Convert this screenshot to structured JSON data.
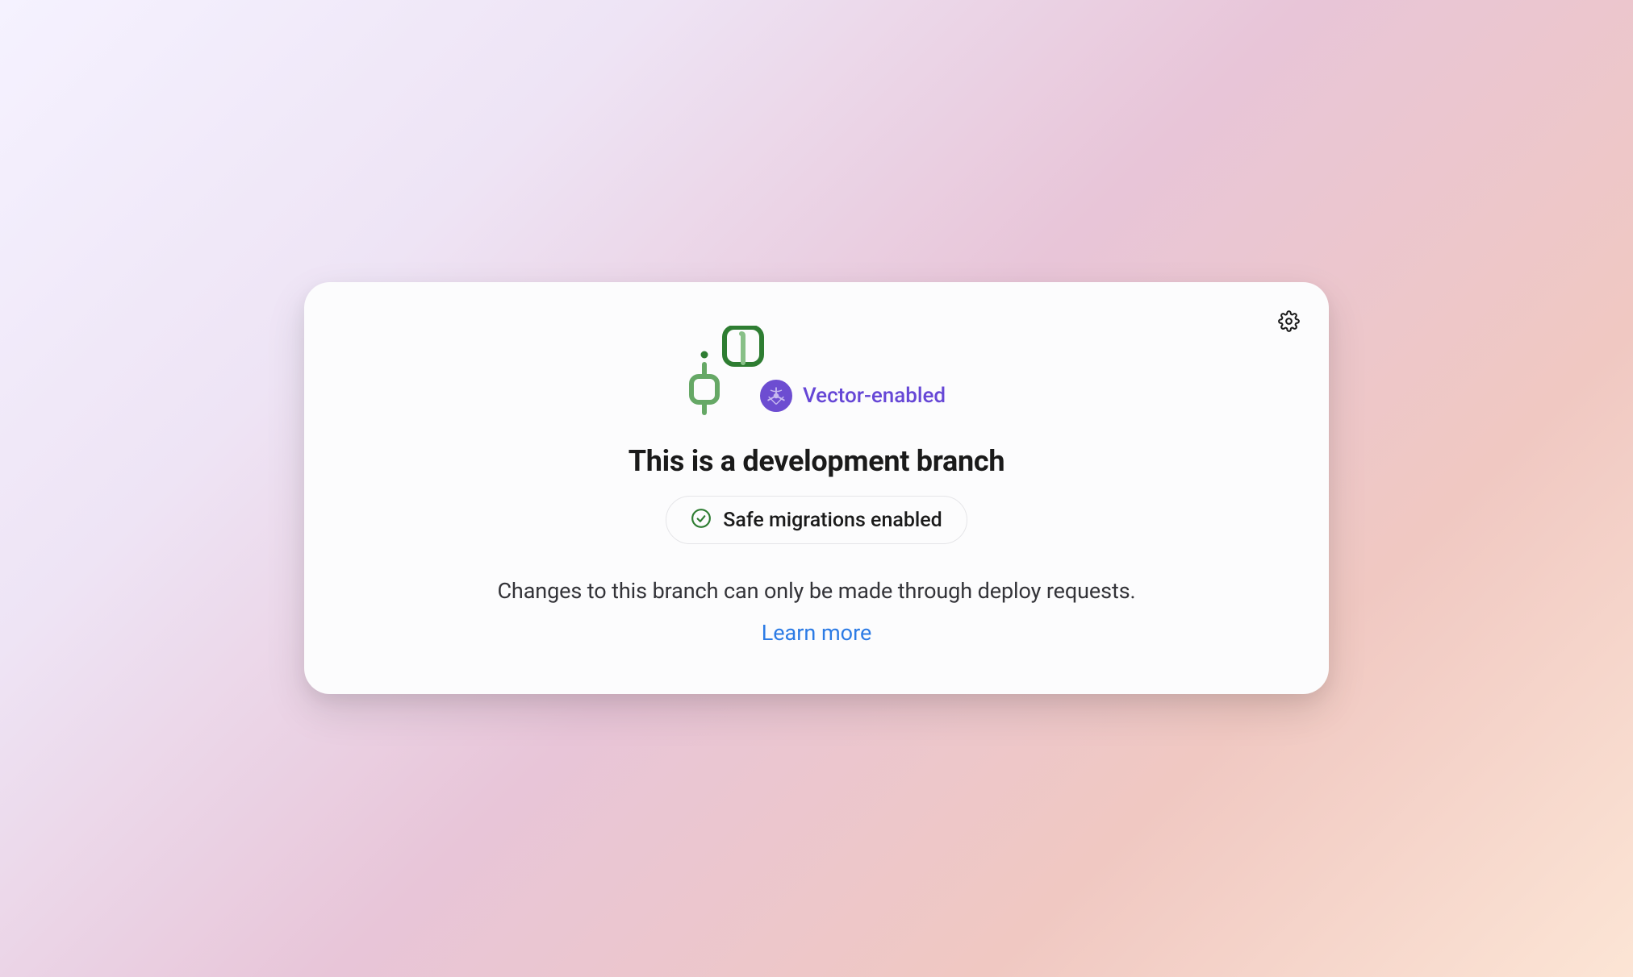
{
  "badge": {
    "label": "Vector-enabled"
  },
  "heading": "This is a development branch",
  "status": {
    "text": "Safe migrations enabled"
  },
  "description": "Changes to this branch can only be made through deploy requests.",
  "learn_more": "Learn more"
}
